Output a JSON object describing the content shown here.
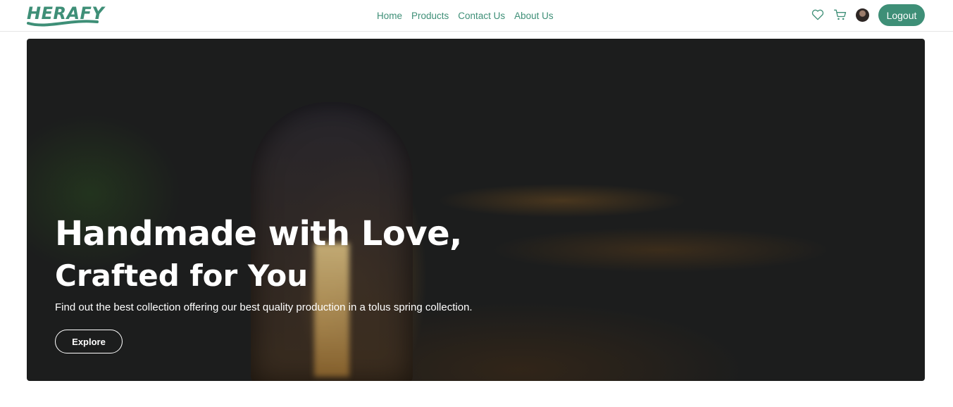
{
  "brand": {
    "name": "HERAFY"
  },
  "nav": {
    "links": [
      "Home",
      "Products",
      "Contact Us",
      "About Us"
    ],
    "logout_label": "Logout"
  },
  "icons": {
    "wishlist": "heart-icon",
    "cart": "cart-icon",
    "avatar": "user-avatar"
  },
  "hero": {
    "title_line1": "Handmade with Love,",
    "title_line2": "Crafted for You",
    "subtitle": "Find out the best collection offering our best quality production in a tolus spring collection.",
    "cta_label": "Explore"
  },
  "colors": {
    "accent": "#3e8f77",
    "hero_text": "#ffffff"
  }
}
